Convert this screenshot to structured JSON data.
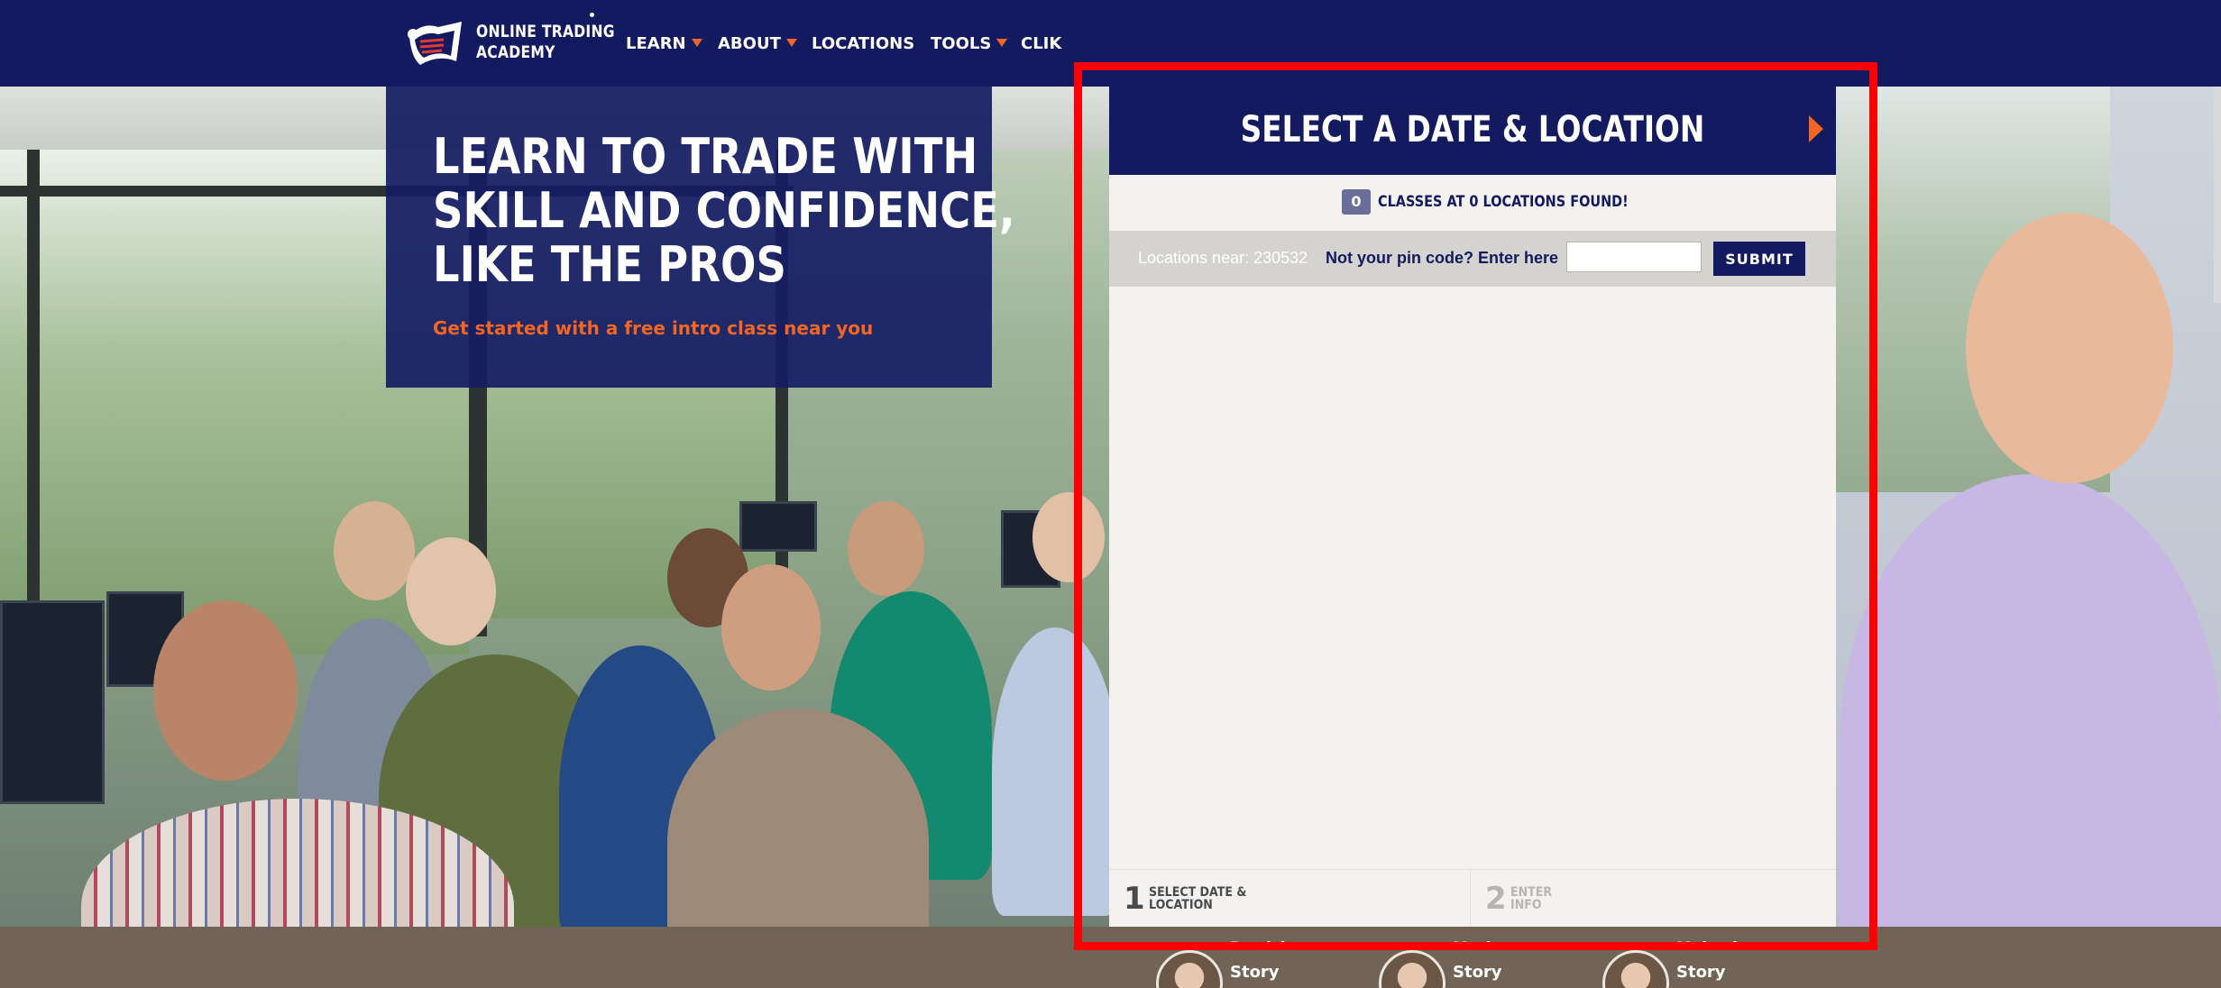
{
  "nav": {
    "logo": {
      "line1": "ONLINE TRADING",
      "line2": "ACADEMY"
    },
    "items": [
      {
        "label": "LEARN",
        "dropdown": true
      },
      {
        "label": "ABOUT",
        "dropdown": true
      },
      {
        "label": "LOCATIONS",
        "dropdown": false
      },
      {
        "label": "TOOLS",
        "dropdown": true
      },
      {
        "label": "CLIK",
        "dropdown": false
      }
    ]
  },
  "hero": {
    "title_lines": [
      "LEARN TO TRADE WITH",
      "SKILL AND CONFIDENCE,",
      "LIKE THE PROS"
    ],
    "cta": "Get started with a free intro class near you"
  },
  "widget": {
    "title": "SELECT A DATE & LOCATION",
    "classes_count": "0",
    "found_text": "CLASSES AT 0 LOCATIONS FOUND!",
    "locations_near": "Locations near: 230532",
    "change_pin": "Not your pin code? Enter here",
    "pin_value": "",
    "pin_placeholder": "",
    "submit_label": "SUBMIT",
    "steps": [
      {
        "number": "1",
        "label_line1": "SELECT DATE &",
        "label_line2": "LOCATION",
        "state": "active"
      },
      {
        "number": "2",
        "label_line1": "ENTER",
        "label_line2": "INFO",
        "state": "inactive"
      }
    ]
  },
  "stories": [
    {
      "name": "Patricia",
      "label": "Story"
    },
    {
      "name": "Mark",
      "label": "Story"
    },
    {
      "name": "Mahesh",
      "label": "Story"
    }
  ],
  "colors": {
    "navy": "#131a5f",
    "orange": "#f26522",
    "widget_bg": "#f3f2f0",
    "highlight": "#ff0000",
    "stories_bg": "#716457"
  },
  "icons": [
    "logo-mark-icon",
    "chevron-right-icon",
    "caret-down-icon"
  ]
}
